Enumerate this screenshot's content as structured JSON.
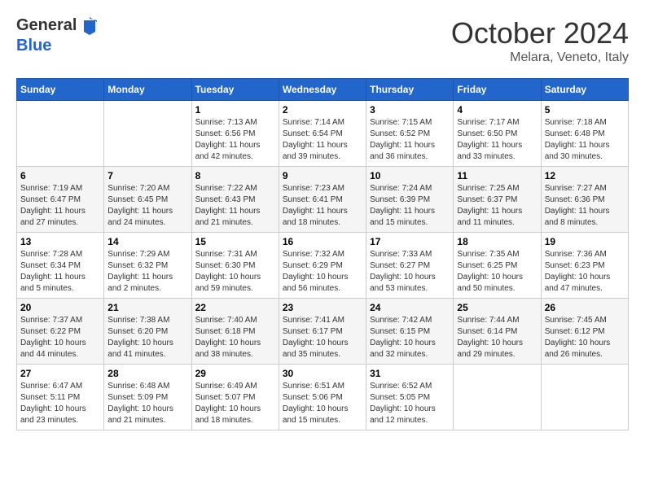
{
  "header": {
    "logo_general": "General",
    "logo_blue": "Blue",
    "month": "October 2024",
    "location": "Melara, Veneto, Italy"
  },
  "days_of_week": [
    "Sunday",
    "Monday",
    "Tuesday",
    "Wednesday",
    "Thursday",
    "Friday",
    "Saturday"
  ],
  "weeks": [
    [
      {
        "day": "",
        "info": ""
      },
      {
        "day": "",
        "info": ""
      },
      {
        "day": "1",
        "info": "Sunrise: 7:13 AM\nSunset: 6:56 PM\nDaylight: 11 hours and 42 minutes."
      },
      {
        "day": "2",
        "info": "Sunrise: 7:14 AM\nSunset: 6:54 PM\nDaylight: 11 hours and 39 minutes."
      },
      {
        "day": "3",
        "info": "Sunrise: 7:15 AM\nSunset: 6:52 PM\nDaylight: 11 hours and 36 minutes."
      },
      {
        "day": "4",
        "info": "Sunrise: 7:17 AM\nSunset: 6:50 PM\nDaylight: 11 hours and 33 minutes."
      },
      {
        "day": "5",
        "info": "Sunrise: 7:18 AM\nSunset: 6:48 PM\nDaylight: 11 hours and 30 minutes."
      }
    ],
    [
      {
        "day": "6",
        "info": "Sunrise: 7:19 AM\nSunset: 6:47 PM\nDaylight: 11 hours and 27 minutes."
      },
      {
        "day": "7",
        "info": "Sunrise: 7:20 AM\nSunset: 6:45 PM\nDaylight: 11 hours and 24 minutes."
      },
      {
        "day": "8",
        "info": "Sunrise: 7:22 AM\nSunset: 6:43 PM\nDaylight: 11 hours and 21 minutes."
      },
      {
        "day": "9",
        "info": "Sunrise: 7:23 AM\nSunset: 6:41 PM\nDaylight: 11 hours and 18 minutes."
      },
      {
        "day": "10",
        "info": "Sunrise: 7:24 AM\nSunset: 6:39 PM\nDaylight: 11 hours and 15 minutes."
      },
      {
        "day": "11",
        "info": "Sunrise: 7:25 AM\nSunset: 6:37 PM\nDaylight: 11 hours and 11 minutes."
      },
      {
        "day": "12",
        "info": "Sunrise: 7:27 AM\nSunset: 6:36 PM\nDaylight: 11 hours and 8 minutes."
      }
    ],
    [
      {
        "day": "13",
        "info": "Sunrise: 7:28 AM\nSunset: 6:34 PM\nDaylight: 11 hours and 5 minutes."
      },
      {
        "day": "14",
        "info": "Sunrise: 7:29 AM\nSunset: 6:32 PM\nDaylight: 11 hours and 2 minutes."
      },
      {
        "day": "15",
        "info": "Sunrise: 7:31 AM\nSunset: 6:30 PM\nDaylight: 10 hours and 59 minutes."
      },
      {
        "day": "16",
        "info": "Sunrise: 7:32 AM\nSunset: 6:29 PM\nDaylight: 10 hours and 56 minutes."
      },
      {
        "day": "17",
        "info": "Sunrise: 7:33 AM\nSunset: 6:27 PM\nDaylight: 10 hours and 53 minutes."
      },
      {
        "day": "18",
        "info": "Sunrise: 7:35 AM\nSunset: 6:25 PM\nDaylight: 10 hours and 50 minutes."
      },
      {
        "day": "19",
        "info": "Sunrise: 7:36 AM\nSunset: 6:23 PM\nDaylight: 10 hours and 47 minutes."
      }
    ],
    [
      {
        "day": "20",
        "info": "Sunrise: 7:37 AM\nSunset: 6:22 PM\nDaylight: 10 hours and 44 minutes."
      },
      {
        "day": "21",
        "info": "Sunrise: 7:38 AM\nSunset: 6:20 PM\nDaylight: 10 hours and 41 minutes."
      },
      {
        "day": "22",
        "info": "Sunrise: 7:40 AM\nSunset: 6:18 PM\nDaylight: 10 hours and 38 minutes."
      },
      {
        "day": "23",
        "info": "Sunrise: 7:41 AM\nSunset: 6:17 PM\nDaylight: 10 hours and 35 minutes."
      },
      {
        "day": "24",
        "info": "Sunrise: 7:42 AM\nSunset: 6:15 PM\nDaylight: 10 hours and 32 minutes."
      },
      {
        "day": "25",
        "info": "Sunrise: 7:44 AM\nSunset: 6:14 PM\nDaylight: 10 hours and 29 minutes."
      },
      {
        "day": "26",
        "info": "Sunrise: 7:45 AM\nSunset: 6:12 PM\nDaylight: 10 hours and 26 minutes."
      }
    ],
    [
      {
        "day": "27",
        "info": "Sunrise: 6:47 AM\nSunset: 5:11 PM\nDaylight: 10 hours and 23 minutes."
      },
      {
        "day": "28",
        "info": "Sunrise: 6:48 AM\nSunset: 5:09 PM\nDaylight: 10 hours and 21 minutes."
      },
      {
        "day": "29",
        "info": "Sunrise: 6:49 AM\nSunset: 5:07 PM\nDaylight: 10 hours and 18 minutes."
      },
      {
        "day": "30",
        "info": "Sunrise: 6:51 AM\nSunset: 5:06 PM\nDaylight: 10 hours and 15 minutes."
      },
      {
        "day": "31",
        "info": "Sunrise: 6:52 AM\nSunset: 5:05 PM\nDaylight: 10 hours and 12 minutes."
      },
      {
        "day": "",
        "info": ""
      },
      {
        "day": "",
        "info": ""
      }
    ]
  ]
}
